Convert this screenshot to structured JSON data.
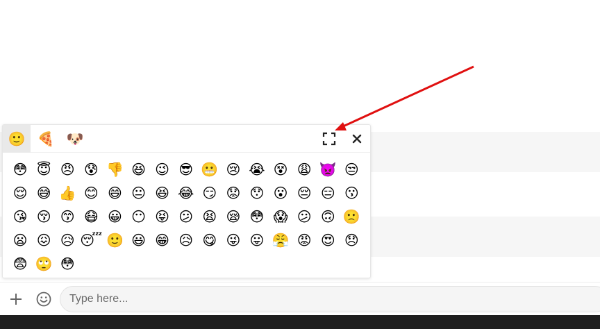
{
  "picker": {
    "categories": [
      {
        "name": "smileys",
        "glyph": "🙂",
        "active": true
      },
      {
        "name": "food",
        "glyph": "🍕",
        "active": false
      },
      {
        "name": "animals",
        "glyph": "🐶",
        "active": false
      }
    ],
    "expand_icon": "expand-icon",
    "close_icon": "close-icon",
    "emojis": [
      "😳",
      "😇",
      "😠",
      "😰",
      "👎",
      "😆",
      "😉",
      "😎",
      "😬",
      "😢",
      "😭",
      "😵",
      "😩",
      "👿",
      "😒",
      "😌",
      "😅",
      "👍",
      "😊",
      "😄",
      "😐",
      "😆",
      "😂",
      "😏",
      "😟",
      "😯",
      "😮",
      "😔",
      "😑",
      "😗",
      "😘",
      "😚",
      "😙",
      "😷",
      "😀",
      "😶",
      "😝",
      "😕",
      "😫",
      "😪",
      "😳",
      "😱",
      "😕",
      "🙃",
      "🙁",
      "😦",
      "😖",
      "😥",
      "😴",
      "🙂",
      "😃",
      "😁",
      "😥",
      "😋",
      "😜",
      "😛",
      "😤",
      "😡",
      "😍",
      "😞",
      "😨",
      "🙄",
      "😳"
    ]
  },
  "composer": {
    "plus_icon": "plus-icon",
    "emoji_icon": "smiley-icon",
    "input_placeholder": "Type here..."
  },
  "annotation": {
    "arrow_color": "#e01010"
  }
}
